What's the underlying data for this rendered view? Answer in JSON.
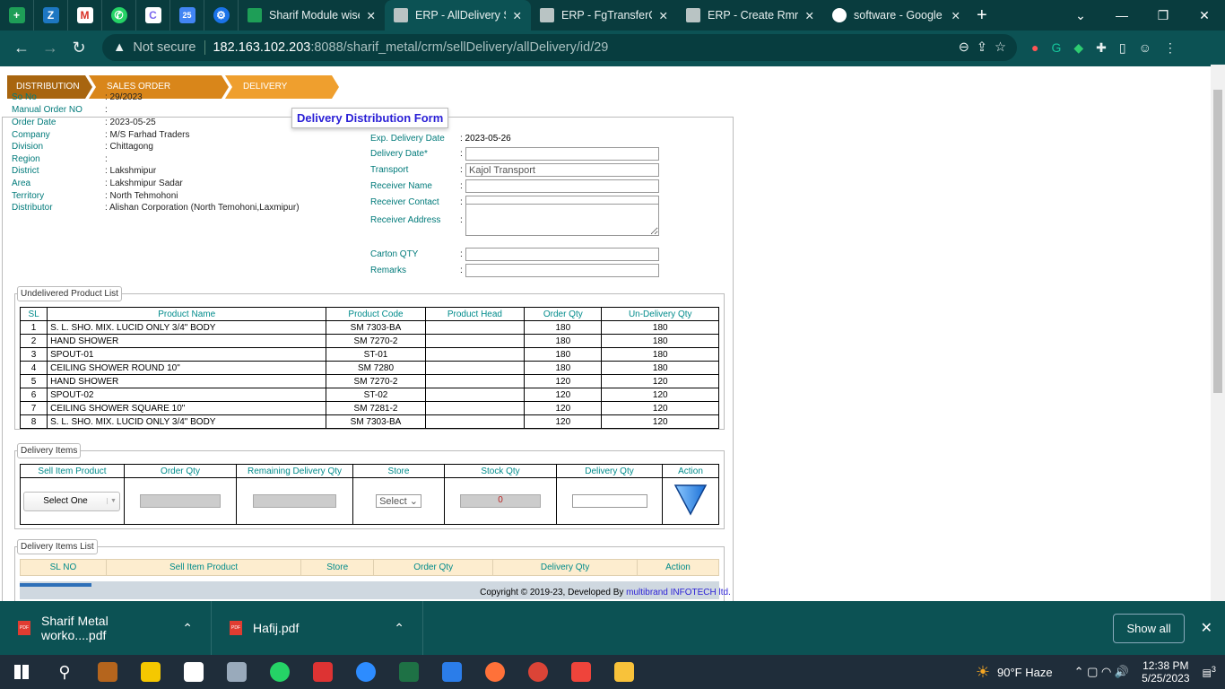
{
  "browser": {
    "pinned_tabs": [
      "sheets",
      "zoho",
      "gmail",
      "whatsapp",
      "clickup",
      "calendar",
      "settings"
    ],
    "tabs": [
      {
        "title": "Sharif Module wise"
      },
      {
        "title": "ERP - AllDelivery S",
        "active": true
      },
      {
        "title": "ERP - FgTransferCr"
      },
      {
        "title": "ERP - Create Rmr"
      },
      {
        "title": "software - Google"
      }
    ],
    "not_secure": "Not secure",
    "url_host": "182.163.102.203",
    "url_path": ":8088/sharif_metal/crm/sellDelivery/allDelivery/id/29"
  },
  "breadcrumb": [
    {
      "label": "DISTRIBUTION",
      "color": "#a8650f"
    },
    {
      "label": "SALES ORDER DELIVERY",
      "color": "#d9861a"
    },
    {
      "label": "DELIVERY CREATE",
      "color": "#ef9f2e"
    }
  ],
  "form": {
    "title": "Delivery Distribution Form",
    "left": [
      {
        "label": "So No",
        "value": ": 29/2023"
      },
      {
        "label": "Manual Order NO",
        "value": ":"
      },
      {
        "label": "Order Date",
        "value": ": 2023-05-25"
      },
      {
        "label": "Company",
        "value": ": M/S Farhad Traders"
      },
      {
        "label": "Division",
        "value": ": Chittagong"
      },
      {
        "label": "Region",
        "value": ":"
      },
      {
        "label": "District",
        "value": ": Lakshmipur"
      },
      {
        "label": "Area",
        "value": ": Lakshmipur Sadar"
      },
      {
        "label": "Territory",
        "value": ": North Tehmohoni"
      },
      {
        "label": "Distributor",
        "value": ": Alishan Corporation (North Temohoni,Laxmipur)"
      }
    ],
    "exp_delivery_label": "Exp. Delivery Date",
    "exp_delivery_value": ": 2023-05-26",
    "right": [
      {
        "label": "Delivery Date*",
        "value": ""
      },
      {
        "label": "Transport",
        "value": "Kajol Transport"
      },
      {
        "label": "Receiver Name",
        "value": ""
      },
      {
        "label": "Receiver Contact",
        "value": ""
      },
      {
        "label": "Receiver Address",
        "value": ""
      },
      {
        "label": "Carton QTY",
        "value": ""
      },
      {
        "label": "Remarks",
        "value": ""
      }
    ],
    "colon": ":"
  },
  "undelivered": {
    "legend": "Undelivered Product List",
    "headers": [
      "SL",
      "Product Name",
      "Product Code",
      "Product Head",
      "Order Qty",
      "Un-Delivery Qty"
    ],
    "rows": [
      [
        "1",
        "S. L. SHO. MIX. LUCID ONLY 3/4\" BODY",
        "SM 7303-BA",
        "",
        "180",
        "180"
      ],
      [
        "2",
        "HAND SHOWER",
        "SM 7270-2",
        "",
        "180",
        "180"
      ],
      [
        "3",
        "SPOUT-01",
        "ST-01",
        "",
        "180",
        "180"
      ],
      [
        "4",
        "CEILING SHOWER ROUND 10\"",
        "SM 7280",
        "",
        "180",
        "180"
      ],
      [
        "5",
        "HAND SHOWER",
        "SM 7270-2",
        "",
        "120",
        "120"
      ],
      [
        "6",
        "SPOUT-02",
        "ST-02",
        "",
        "120",
        "120"
      ],
      [
        "7",
        "CEILING SHOWER SQUARE 10\"",
        "SM 7281-2",
        "",
        "120",
        "120"
      ],
      [
        "8",
        "S. L. SHO. MIX. LUCID ONLY 3/4\" BODY",
        "SM 7303-BA",
        "",
        "120",
        "120"
      ]
    ]
  },
  "delivery_items": {
    "legend": "Delivery Items",
    "headers": [
      "Sell Item Product",
      "Order Qty",
      "Remaining Delivery Qty",
      "Store",
      "Stock Qty",
      "Delivery Qty",
      "Action"
    ],
    "product_select": "Select One",
    "store_select": "Select",
    "stock_qty": "0"
  },
  "delivery_list": {
    "legend": "Delivery Items List",
    "headers": [
      "SL NO",
      "Sell Item Product",
      "Store",
      "Order Qty",
      "Delivery Qty",
      "Action"
    ]
  },
  "footer": {
    "text": "Copyright © 2019-23, Developed By ",
    "link": "multibrand INFOTECH ltd."
  },
  "downloads": {
    "items": [
      "Sharif Metal worko....pdf",
      "Hafij.pdf"
    ],
    "show_all": "Show all"
  },
  "taskbar": {
    "weather": "90°F  Haze",
    "time": "12:38 PM",
    "date": "5/25/2023",
    "notifications": "3"
  }
}
